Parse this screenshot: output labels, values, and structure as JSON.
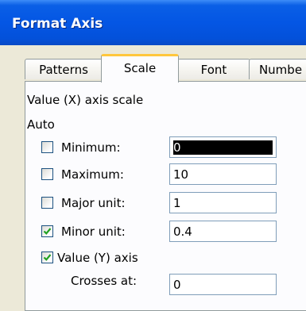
{
  "dialog": {
    "title": "Format Axis"
  },
  "tabs": [
    {
      "label": "Patterns",
      "active": false
    },
    {
      "label": "Scale",
      "active": true
    },
    {
      "label": "Font",
      "active": false
    },
    {
      "label": "Numbe",
      "active": false
    }
  ],
  "scale": {
    "section_label": "Value (X) axis scale",
    "auto_label": "Auto",
    "minimum": {
      "label": "Minimum:",
      "value": "0",
      "checked": false
    },
    "maximum": {
      "label": "Maximum:",
      "value": "10",
      "checked": false
    },
    "major_unit": {
      "label": "Major unit:",
      "value": "1",
      "checked": false
    },
    "minor_unit": {
      "label": "Minor unit:",
      "value": "0.4",
      "checked": true
    },
    "value_y_axis": {
      "label": "Value (Y) axis",
      "checked": true
    },
    "crosses_at": {
      "label": "Crosses at:",
      "value": "0"
    }
  },
  "colors": {
    "title_bar": "#0456e4",
    "dialog_bg": "#ece9d8",
    "active_tab_accent": "#ffc73c",
    "checkmark": "#21a121"
  }
}
